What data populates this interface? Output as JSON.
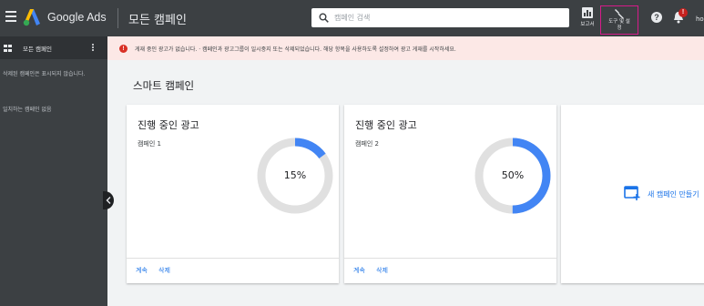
{
  "header": {
    "brand": "Google Ads",
    "page_title": "모든 캠페인",
    "search_placeholder": "캠페인 검색",
    "report_label": "보고서",
    "tools_label_1": "도구 및 설",
    "tools_label_2": "정",
    "help_label": "?",
    "notification_badge": "!",
    "account_text": "ho"
  },
  "sidebar": {
    "title": "모든 캠페인",
    "removed_notice": "삭제된 캠페인은 표시되지 않습니다.",
    "no_match": "일치하는 캠페인 없음"
  },
  "alert": {
    "icon": "!",
    "message": "게재 중인 광고가 없습니다. · 캠페인과 광고그룹이 일시중지 또는 삭제되었습니다. 해당 항목을 사용하도록 설정하여 광고 게재를 시작하세요."
  },
  "main": {
    "section_title": "스마트 캠페인",
    "cards": [
      {
        "title": "진행 중인 광고",
        "campaign": "캠페인 1",
        "progress_label": "15%",
        "progress": 0.15,
        "continue": "계속",
        "delete": "삭제"
      },
      {
        "title": "진행 중인 광고",
        "campaign": "캠페인 2",
        "progress_label": "50%",
        "progress": 0.5,
        "continue": "계속",
        "delete": "삭제"
      }
    ],
    "new_campaign_label": "새 캠페인 만들기"
  },
  "colors": {
    "accent": "#1a73e8",
    "progress": "#4285f4",
    "track": "#e0e0e0",
    "topbar": "#3c4043",
    "alert_bg": "#fce8e6",
    "highlight": "#d61b8a"
  }
}
